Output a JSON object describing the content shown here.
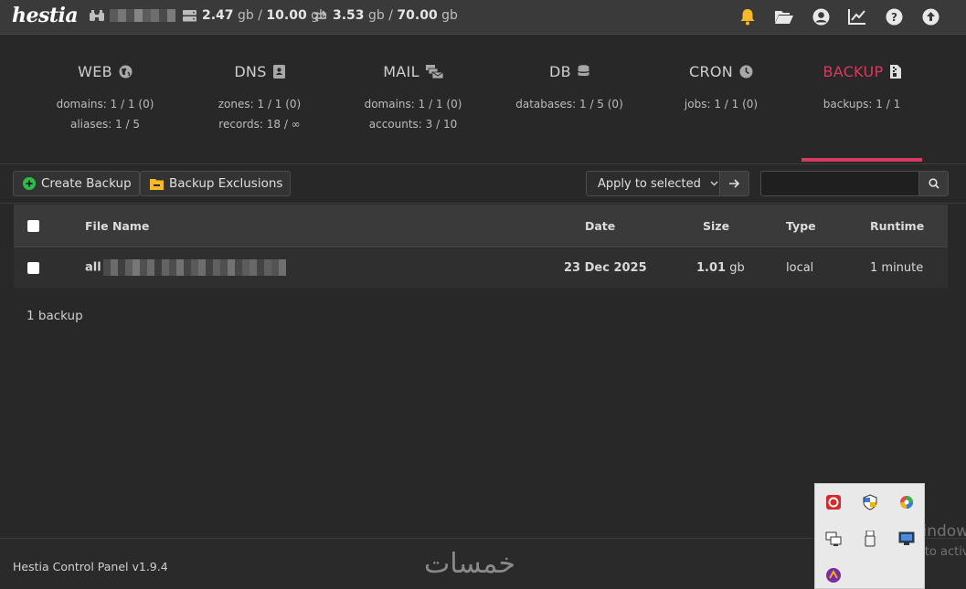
{
  "header": {
    "logo": "hestia",
    "disk_used": "2.47",
    "disk_unit1": "gb /",
    "disk_total": "10.00",
    "disk_unit2": "gb",
    "bw_used": "3.53",
    "bw_unit1": "gb /",
    "bw_total": "70.00",
    "bw_unit2": "gb",
    "icons": [
      "bell-icon",
      "folder-open-icon",
      "user-circle-icon",
      "chart-line-icon",
      "help-icon",
      "upload-icon"
    ]
  },
  "tabs": [
    {
      "title": "WEB",
      "icon": "globe-icon",
      "line1": "domains: 1 / 1 (0)",
      "line2": "aliases: 1 / 5"
    },
    {
      "title": "DNS",
      "icon": "address-book-icon",
      "line1": "zones: 1 / 1 (0)",
      "line2": "records: 18 / ∞"
    },
    {
      "title": "MAIL",
      "icon": "mail-bulk-icon",
      "line1": "domains: 1 / 1 (0)",
      "line2": "accounts: 3 / 10"
    },
    {
      "title": "DB",
      "icon": "database-icon",
      "line1": "databases: 1 / 5 (0)",
      "line2": ""
    },
    {
      "title": "CRON",
      "icon": "clock-icon",
      "line1": "jobs: 1 / 1 (0)",
      "line2": ""
    },
    {
      "title": "BACKUP",
      "icon": "file-zipper-icon",
      "line1": "backups: 1 / 1",
      "line2": "",
      "active": true
    }
  ],
  "toolbar": {
    "create_backup": "Create Backup",
    "backup_exclusions": "Backup Exclusions",
    "apply_to_selected": "Apply to selected",
    "search_placeholder": ""
  },
  "table": {
    "headers": {
      "file_name": "File Name",
      "date": "Date",
      "size": "Size",
      "type": "Type",
      "runtime": "Runtime"
    },
    "rows": [
      {
        "file_name": "all",
        "date": "23 Dec 2025",
        "size_value": "1.01",
        "size_unit": "gb",
        "type": "local",
        "runtime": "1 minute"
      }
    ]
  },
  "count": "1 backup",
  "footer": {
    "version": "Hestia Control Panel v1.9.4",
    "watermark": "خمسات"
  },
  "overlay": {
    "activate_title": "Activate Windows",
    "activate_sub": "Go to Settings to activate Windows."
  },
  "colors": {
    "accent": "#d83a5e",
    "green": "#2bbd4a",
    "yellow": "#f7b928",
    "bell": "#f7b928"
  }
}
